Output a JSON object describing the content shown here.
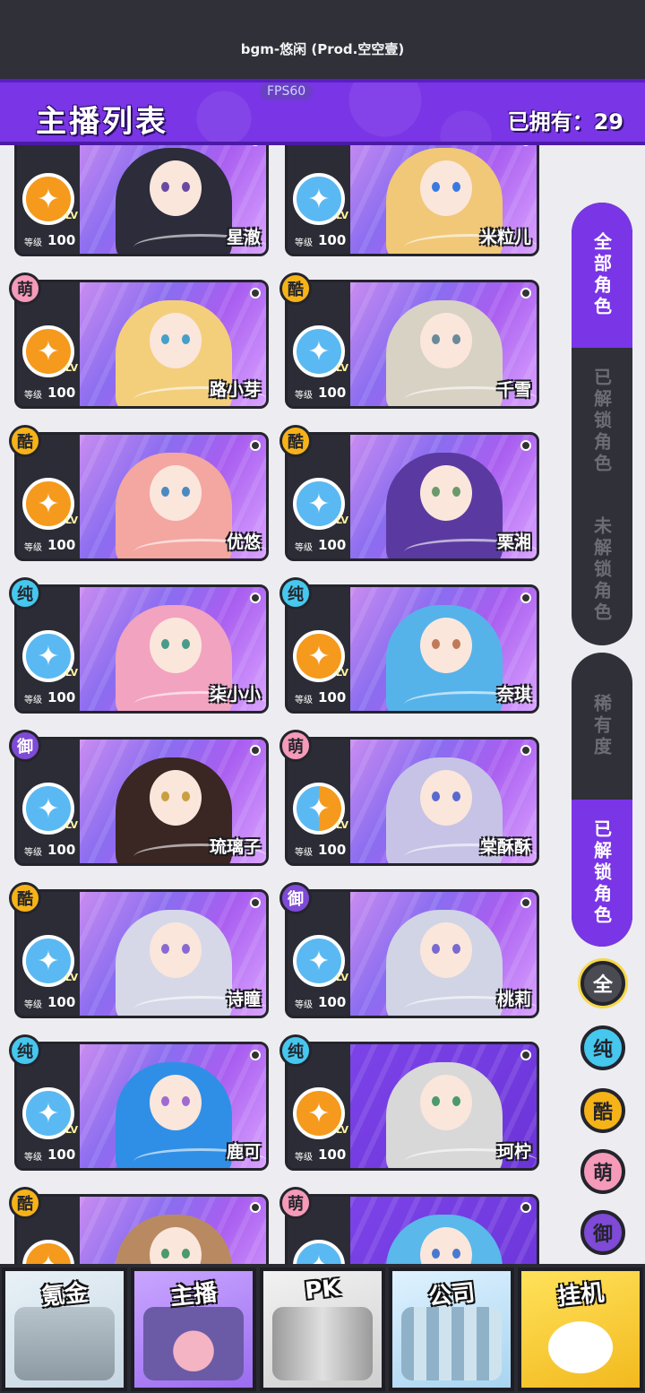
{
  "top": {
    "bgm_text": "bgm-悠闲 (Prod.空空壹)",
    "fps": "FPS60"
  },
  "header": {
    "title": "主播列表",
    "owned": "已拥有：29"
  },
  "level_label": "等级",
  "lv_tag": "LV",
  "cards": [
    {
      "name": "星澈",
      "level": "100",
      "badge": "",
      "emblem": "orange"
    },
    {
      "name": "米粒儿",
      "level": "100",
      "badge": "",
      "emblem": "blue"
    },
    {
      "name": "路小芽",
      "level": "100",
      "badge": "萌",
      "emblem": "orange"
    },
    {
      "name": "千雪",
      "level": "100",
      "badge": "酷",
      "emblem": "blue"
    },
    {
      "name": "优悠",
      "level": "100",
      "badge": "酷",
      "emblem": "orange"
    },
    {
      "name": "栗湘",
      "level": "100",
      "badge": "酷",
      "emblem": "blue"
    },
    {
      "name": "柒小小",
      "level": "100",
      "badge": "纯",
      "emblem": "blue"
    },
    {
      "name": "奈琪",
      "level": "100",
      "badge": "纯",
      "emblem": "orange"
    },
    {
      "name": "琉璃子",
      "level": "100",
      "badge": "御",
      "emblem": "blue"
    },
    {
      "name": "棠酥酥",
      "level": "100",
      "badge": "萌",
      "emblem": "mix"
    },
    {
      "name": "诗瞳",
      "level": "100",
      "badge": "酷",
      "emblem": "blue"
    },
    {
      "name": "桃莉",
      "level": "100",
      "badge": "御",
      "emblem": "blue"
    },
    {
      "name": "鹿可",
      "level": "100",
      "badge": "纯",
      "emblem": "blue"
    },
    {
      "name": "珂柠",
      "level": "100",
      "badge": "纯",
      "emblem": "orange"
    },
    {
      "name": "",
      "level": "",
      "badge": "酷",
      "emblem": "orange"
    },
    {
      "name": "",
      "level": "",
      "badge": "萌",
      "emblem": "blue"
    }
  ],
  "sidebar": {
    "group1": [
      "全部角色",
      "已解锁角色",
      "未解锁角色"
    ],
    "group2": [
      "稀有度",
      "已解锁角色"
    ]
  },
  "filters": [
    "全",
    "纯",
    "酷",
    "萌",
    "御"
  ],
  "bottom_tabs": [
    "氪金",
    "主播",
    "PK",
    "公司",
    "挂机"
  ],
  "colors": {
    "accent": "#7a35e6",
    "badge_meng": "#f59ab8",
    "badge_ku": "#f6b318",
    "badge_chun": "#45c7ee",
    "badge_yu": "#7e4ad6"
  }
}
